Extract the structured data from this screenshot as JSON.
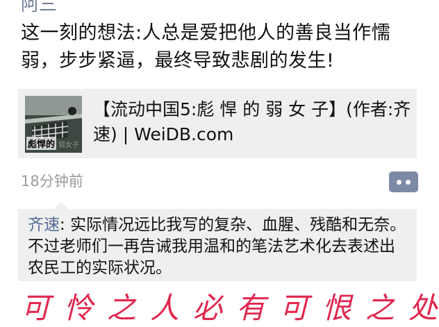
{
  "post": {
    "author_partial": "阿三",
    "text": "这一刻的想法:人总是爱把他人的善良当作懦弱，步步紧逼，最终导致悲剧的发生!",
    "shared_link": {
      "title": "【流动中国5:彪 悍 的 弱 女 子】(作者:齐速) | WeiDB.com",
      "thumbnail_caption": "彪悍的",
      "thumbnail_caption_faint": "弱女子"
    },
    "timestamp": "18分钟前",
    "action_icon": "more-dots-icon"
  },
  "comment": {
    "author": "齐速",
    "separator": ": ",
    "text": "实际情况远比我写的复杂、血腥、残酷和无奈。不过老师们一再告诫我用温和的笔法艺术化去表述出农民工的实际状况。"
  },
  "annotation": {
    "handwritten_text": "可怜之人必有可恨之处",
    "color": "#e0284f"
  },
  "colors": {
    "link_blue": "#576b95",
    "card_bg": "#efefef",
    "timestamp_gray": "#9a9a9a",
    "button_bg": "#7d8aa6"
  }
}
